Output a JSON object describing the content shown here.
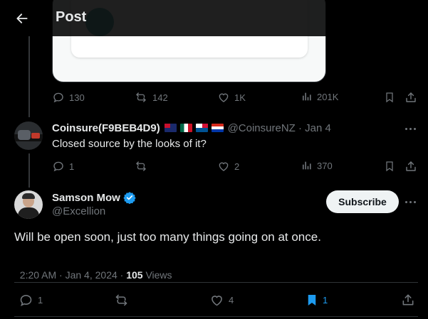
{
  "header": {
    "title": "Post"
  },
  "quoted_post": {
    "actions": {
      "replies": "130",
      "reposts": "142",
      "likes": "1K",
      "views": "201K"
    }
  },
  "reply": {
    "display_name": "Coinsure(F9BEB4D9)",
    "flags": [
      "nz",
      "mx",
      "pa",
      "py"
    ],
    "handle": "@CoinsureNZ",
    "separator": "·",
    "date": "Jan 4",
    "text": "Closed source by the looks of it?",
    "actions": {
      "replies": "1",
      "reposts": "",
      "likes": "2",
      "views": "370"
    }
  },
  "main_post": {
    "display_name": "Samson Mow",
    "handle": "@Excellion",
    "subscribe_label": "Subscribe",
    "text": "Will be open soon, just too many things going on at once.",
    "time": "2:20 AM · Jan 4, 2024 · ",
    "views_count": "105",
    "views_label": " Views",
    "actions": {
      "replies": "1",
      "reposts": "",
      "likes": "4",
      "bookmarks": "1"
    }
  },
  "colors": {
    "accent": "#1d9bf0",
    "muted": "#71767b",
    "text": "#e7e9ea",
    "background": "#000000"
  },
  "icons": [
    "back-arrow-icon",
    "reply-icon",
    "repost-icon",
    "like-icon",
    "views-icon",
    "bookmark-icon",
    "share-icon",
    "more-icon",
    "verified-icon"
  ]
}
